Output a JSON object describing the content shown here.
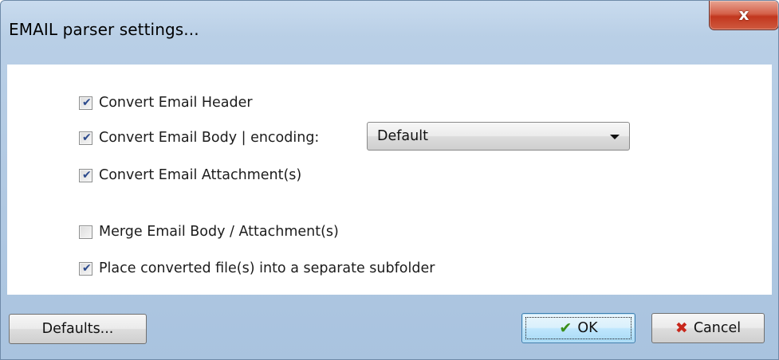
{
  "window": {
    "title": "EMAIL parser settings..."
  },
  "close_button": {
    "label": "x"
  },
  "options": {
    "convert_header": {
      "label": "Convert Email Header",
      "checked": true
    },
    "convert_body": {
      "label": "Convert Email Body | encoding:",
      "checked": true
    },
    "convert_attachments": {
      "label": "Convert Email Attachment(s)",
      "checked": true
    },
    "merge": {
      "label": "Merge Email Body / Attachment(s)",
      "checked": false
    },
    "subfolder": {
      "label": "Place converted file(s) into a separate subfolder",
      "checked": true
    }
  },
  "encoding_select": {
    "value": "Default"
  },
  "buttons": {
    "defaults": "Defaults...",
    "ok": "OK",
    "cancel": "Cancel"
  },
  "icons": {
    "check": "check-mark-icon",
    "ok": "green-check-icon",
    "cancel": "red-x-icon",
    "dropdown": "triangle-down-icon"
  },
  "colors": {
    "accent": "#3c7fb1",
    "close_button": "#c2371e",
    "ok_icon": "#3a8f1a",
    "cancel_icon": "#c8281c"
  }
}
